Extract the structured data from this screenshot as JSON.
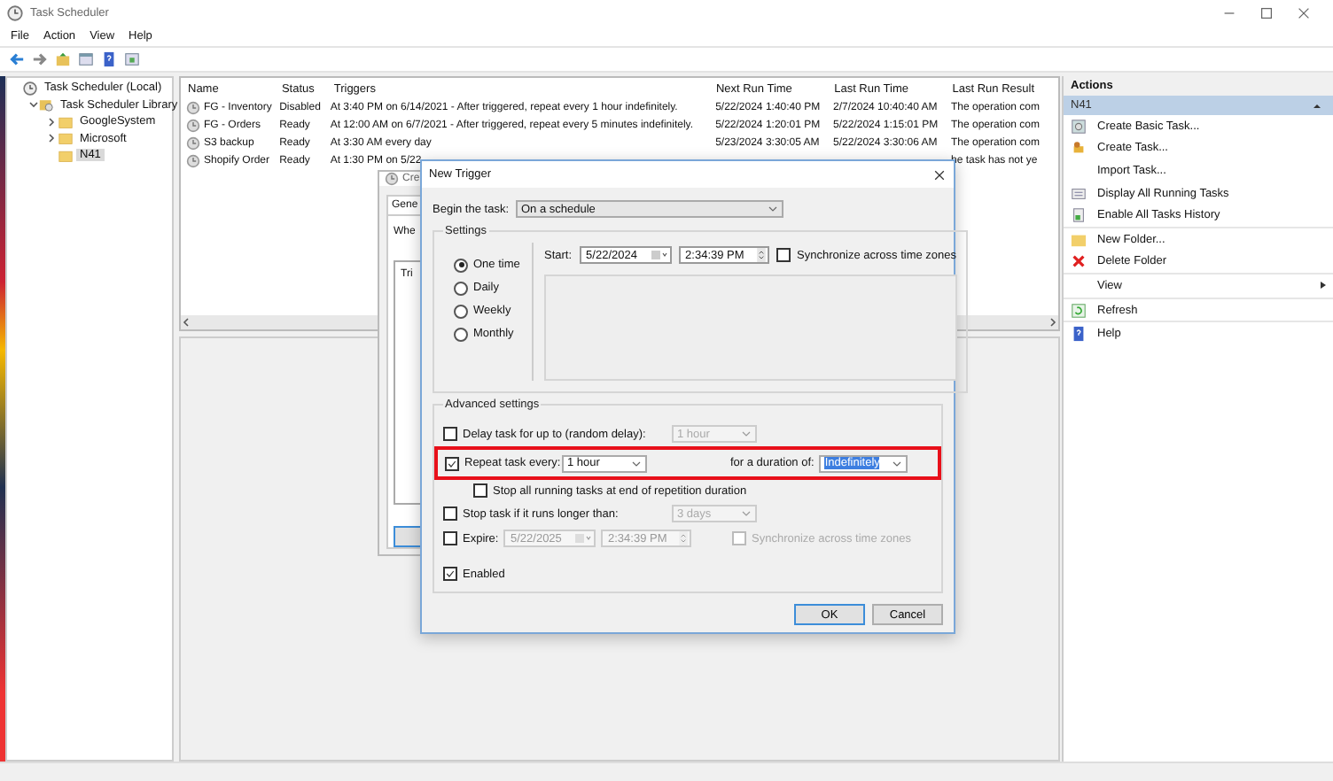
{
  "window": {
    "title": "Task Scheduler"
  },
  "menu": [
    "File",
    "Action",
    "View",
    "Help"
  ],
  "tree": [
    {
      "label": "Task Scheduler (Local)",
      "selected": false,
      "children": [
        {
          "label": "Task Scheduler Library",
          "selected": false,
          "expanded": true,
          "children": [
            {
              "label": "GoogleSystem",
              "selected": false,
              "expanded": false
            },
            {
              "label": "Microsoft",
              "selected": false,
              "expanded": false
            },
            {
              "label": "N41",
              "selected": true
            }
          ]
        }
      ]
    }
  ],
  "table": {
    "columns": [
      "Name",
      "Status",
      "Triggers",
      "Next Run Time",
      "Last Run Time",
      "Last Run Result"
    ],
    "rows": [
      {
        "cells": [
          "FG - Inventory",
          "Disabled",
          "At 3:40 PM on 6/14/2021 - After triggered, repeat every 1 hour indefinitely.",
          "5/22/2024 1:40:40 PM",
          "2/7/2024 10:40:40 AM",
          "The operation com"
        ]
      },
      {
        "cells": [
          "FG - Orders",
          "Ready",
          "At 12:00 AM on 6/7/2021 - After triggered, repeat every 5 minutes indefinitely.",
          "5/22/2024 1:20:01 PM",
          "5/22/2024 1:15:01 PM",
          "The operation com"
        ]
      },
      {
        "cells": [
          "S3 backup",
          "Ready",
          "At 3:30 AM every day",
          "5/23/2024 3:30:05 AM",
          "5/22/2024 3:30:06 AM",
          "The operation com"
        ]
      },
      {
        "cells": [
          "Shopify Order",
          "Ready",
          "At 1:30 PM on 5/22",
          "",
          "",
          "he task has not ye"
        ]
      }
    ]
  },
  "actions": {
    "title": "Actions",
    "section": "N41",
    "items": [
      {
        "label": "Create Basic Task...",
        "kind": "wizard"
      },
      {
        "label": "Create Task...",
        "kind": "task"
      },
      {
        "label": "Import Task...",
        "kind": "none"
      },
      {
        "label": "Display All Running Tasks",
        "kind": "list"
      },
      {
        "label": "Enable All Tasks History",
        "kind": "history"
      },
      {
        "label": "New Folder...",
        "kind": "folder"
      },
      {
        "label": "Delete Folder",
        "kind": "delete"
      },
      {
        "label": "View",
        "kind": "submenu"
      },
      {
        "label": "Refresh",
        "kind": "refresh"
      },
      {
        "label": "Help",
        "kind": "help"
      }
    ]
  },
  "create_task": {
    "title": "Cre",
    "tab": "Gene",
    "prompt": "Whe",
    "list_header": "Tri"
  },
  "new_trigger": {
    "title": "New Trigger",
    "begin_label": "Begin the task:",
    "begin_value": "On a schedule",
    "settings_label": "Settings",
    "schedules": [
      {
        "label": "One time",
        "selected": true
      },
      {
        "label": "Daily",
        "selected": false
      },
      {
        "label": "Weekly",
        "selected": false
      },
      {
        "label": "Monthly",
        "selected": false
      }
    ],
    "start_label": "Start:",
    "start_date": "5/22/2024",
    "start_time": "2:34:39 PM",
    "sync": {
      "label": "Synchronize across time zones",
      "checked": false
    },
    "advanced_label": "Advanced settings",
    "delay": {
      "label": "Delay task for up to (random delay):",
      "checked": false,
      "value": "1 hour"
    },
    "repeat": {
      "label": "Repeat task every:",
      "checked": true,
      "value": "1 hour",
      "duration_label": "for a duration of:",
      "duration_value": "Indefinitely",
      "highlighted": true
    },
    "stop_all": {
      "label": "Stop all running tasks at end of repetition duration",
      "checked": false
    },
    "stop_long": {
      "label": "Stop task if it runs longer than:",
      "checked": false,
      "value": "3 days"
    },
    "expire": {
      "label": "Expire:",
      "checked": false,
      "date": "5/22/2025",
      "time": "2:34:39 PM",
      "sync_label": "Synchronize across time zones",
      "sync_checked": false
    },
    "enabled": {
      "label": "Enabled",
      "checked": true
    },
    "buttons": [
      "OK",
      "Cancel"
    ]
  }
}
